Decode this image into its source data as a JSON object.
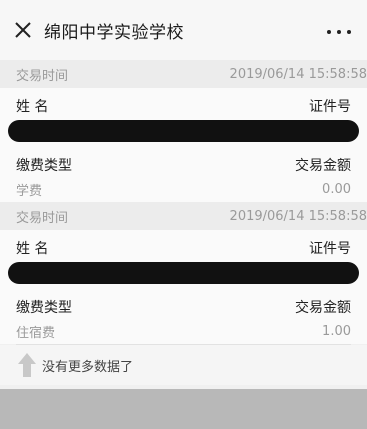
{
  "header": {
    "title": "绵阳中学实验学校",
    "close_icon": "close-icon",
    "more_icon": "more-icon"
  },
  "records": [
    {
      "time_label": "交易时间",
      "time_value": "2019/06/14 15:58:58",
      "name_label": "姓 名",
      "id_label": "证件号",
      "fee_type_label": "缴费类型",
      "amount_label": "交易金额",
      "fee_type": "学费",
      "amount": "0.00"
    },
    {
      "time_label": "交易时间",
      "time_value": "2019/06/14 15:58:58",
      "name_label": "姓 名",
      "id_label": "证件号",
      "fee_type_label": "缴费类型",
      "amount_label": "交易金额",
      "fee_type": "住宿费",
      "amount": "1.00"
    }
  ],
  "footer": {
    "no_more_text": "没有更多数据了",
    "arrow_icon": "arrow-up-icon"
  }
}
